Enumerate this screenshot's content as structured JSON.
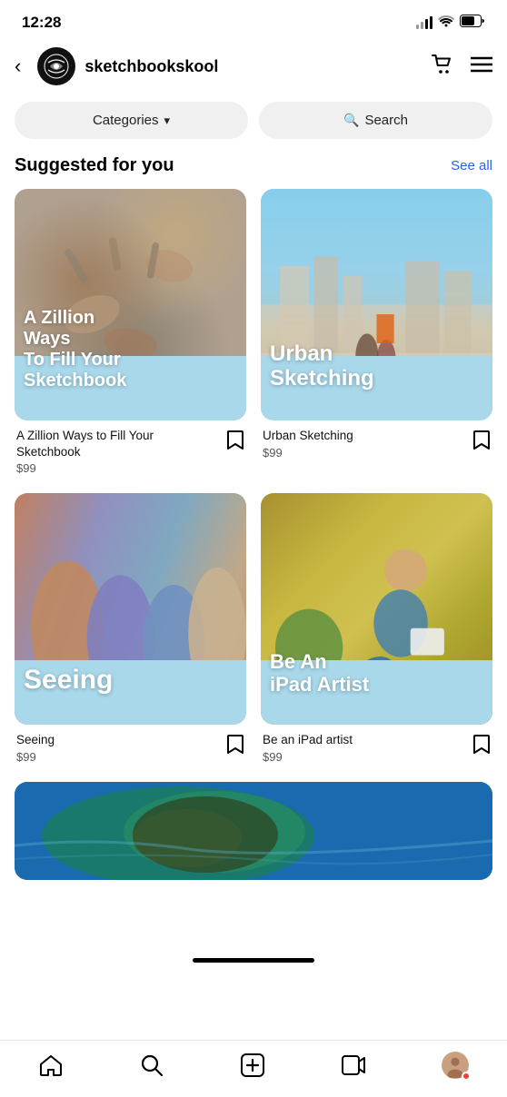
{
  "status": {
    "time": "12:28"
  },
  "header": {
    "back_label": "<",
    "channel_name": "sketchbookskool",
    "cart_icon": "cart-icon",
    "menu_icon": "menu-icon"
  },
  "filter_bar": {
    "categories_label": "Categories",
    "categories_chevron": "▾",
    "search_label": "Search",
    "search_icon": "🔍"
  },
  "suggested": {
    "title": "Suggested for you",
    "see_all_label": "See all",
    "courses": [
      {
        "id": 1,
        "thumbnail_title": "A Zillion Ways To Fill Your Sketchbook",
        "name": "A Zillion Ways to Fill Your Sketchbook",
        "price": "$99"
      },
      {
        "id": 2,
        "thumbnail_title": "Urban Sketching",
        "name": "Urban Sketching",
        "price": "$99"
      },
      {
        "id": 3,
        "thumbnail_title": "Seeing",
        "name": "Seeing",
        "price": "$99"
      },
      {
        "id": 4,
        "thumbnail_title": "Be An iPad Artist",
        "name": "Be an iPad artist",
        "price": "$99"
      }
    ]
  },
  "bottom_nav": {
    "items": [
      {
        "id": "home",
        "label": "Home"
      },
      {
        "id": "search",
        "label": "Search"
      },
      {
        "id": "add",
        "label": "Add"
      },
      {
        "id": "video",
        "label": "Video"
      },
      {
        "id": "profile",
        "label": "Profile"
      }
    ]
  }
}
